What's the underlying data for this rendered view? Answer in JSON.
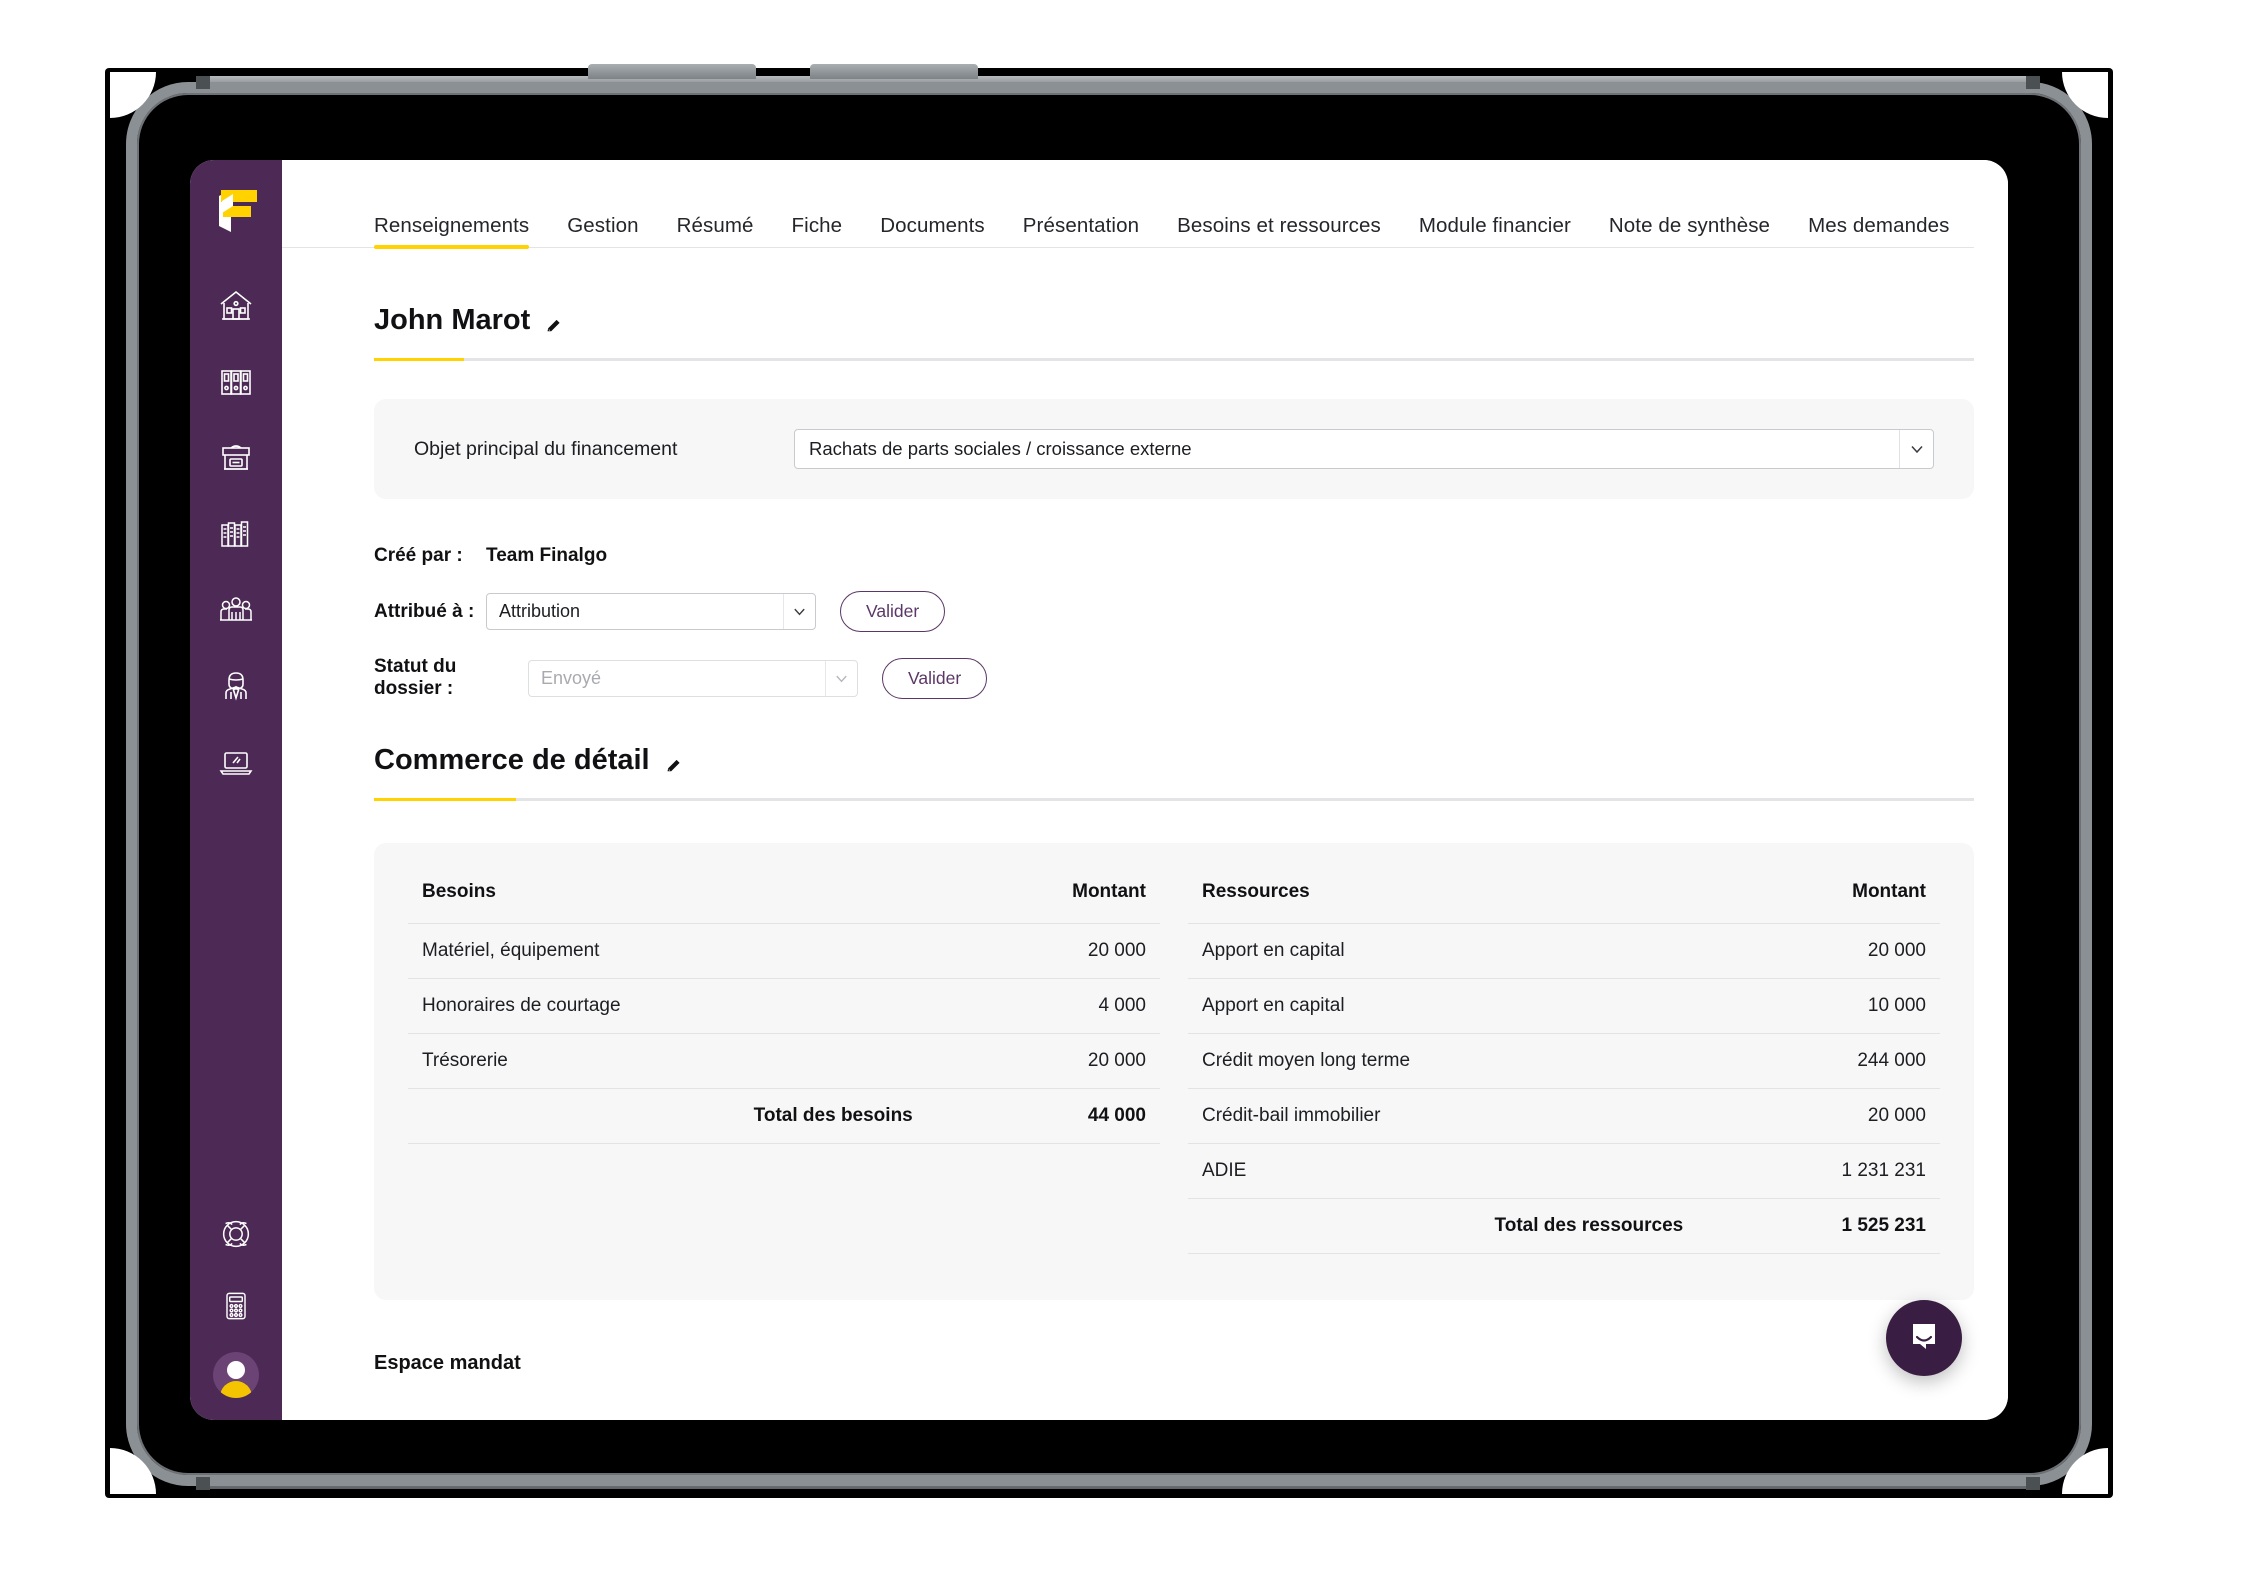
{
  "app": {
    "logo_name": "finalgo-logo",
    "brand_purple": "#4C2A55",
    "brand_yellow": "#FFD200"
  },
  "sidebar": {
    "items": [
      {
        "icon": "home-icon",
        "label": "Accueil"
      },
      {
        "icon": "binders-icon",
        "label": "Dossiers"
      },
      {
        "icon": "archive-box-icon",
        "label": "Archives"
      },
      {
        "icon": "books-icon",
        "label": "Bibliothèque"
      },
      {
        "icon": "group-people-icon",
        "label": "Équipes"
      },
      {
        "icon": "person-tie-icon",
        "label": "Conseiller"
      },
      {
        "icon": "laptop-icon",
        "label": "Outils"
      }
    ],
    "bottom_items": [
      {
        "icon": "life-ring-icon",
        "label": "Aide"
      },
      {
        "icon": "calculator-icon",
        "label": "Calculatrice"
      },
      {
        "icon": "avatar-icon",
        "label": "Mon compte"
      }
    ]
  },
  "tabs": [
    {
      "label": "Renseignements",
      "active": true
    },
    {
      "label": "Gestion",
      "active": false
    },
    {
      "label": "Résumé",
      "active": false
    },
    {
      "label": "Fiche",
      "active": false
    },
    {
      "label": "Documents",
      "active": false
    },
    {
      "label": "Présentation",
      "active": false
    },
    {
      "label": "Besoins et ressources",
      "active": false
    },
    {
      "label": "Module financier",
      "active": false
    },
    {
      "label": "Note de synthèse",
      "active": false
    },
    {
      "label": "Mes demandes",
      "active": false
    }
  ],
  "client": {
    "name": "John Marot",
    "edit_icon": "pencil-icon"
  },
  "financing": {
    "label": "Objet principal du financement",
    "selected": "Rachats de parts sociales / croissance externe"
  },
  "meta": {
    "created_by_label": "Créé par :",
    "created_by_value": "Team Finalgo",
    "assigned_label": "Attribué à :",
    "assigned_value": "Attribution",
    "assigned_validate": "Valider",
    "status_label": "Statut du dossier :",
    "status_value": "Envoyé",
    "status_validate": "Valider"
  },
  "activity": {
    "name": "Commerce de détail",
    "edit_icon": "pencil-icon"
  },
  "besoins_table": {
    "headers": [
      "Besoins",
      "Montant"
    ],
    "rows": [
      {
        "label": "Matériel, équipement",
        "amount": "20 000"
      },
      {
        "label": "Honoraires de courtage",
        "amount": "4 000"
      },
      {
        "label": "Trésorerie",
        "amount": "20 000"
      }
    ],
    "total_label": "Total des besoins",
    "total_amount": "44 000"
  },
  "ressources_table": {
    "headers": [
      "Ressources",
      "Montant"
    ],
    "rows": [
      {
        "label": "Apport en capital",
        "amount": "20 000"
      },
      {
        "label": "Apport en capital",
        "amount": "10 000"
      },
      {
        "label": "Crédit moyen long terme",
        "amount": "244 000"
      },
      {
        "label": "Crédit-bail immobilier",
        "amount": "20 000"
      },
      {
        "label": "ADIE",
        "amount": "1 231 231"
      }
    ],
    "total_label": "Total des ressources",
    "total_amount": "1 525 231"
  },
  "espace_mandat": "Espace mandat",
  "chat": {
    "icon": "chat-bubble-icon"
  }
}
